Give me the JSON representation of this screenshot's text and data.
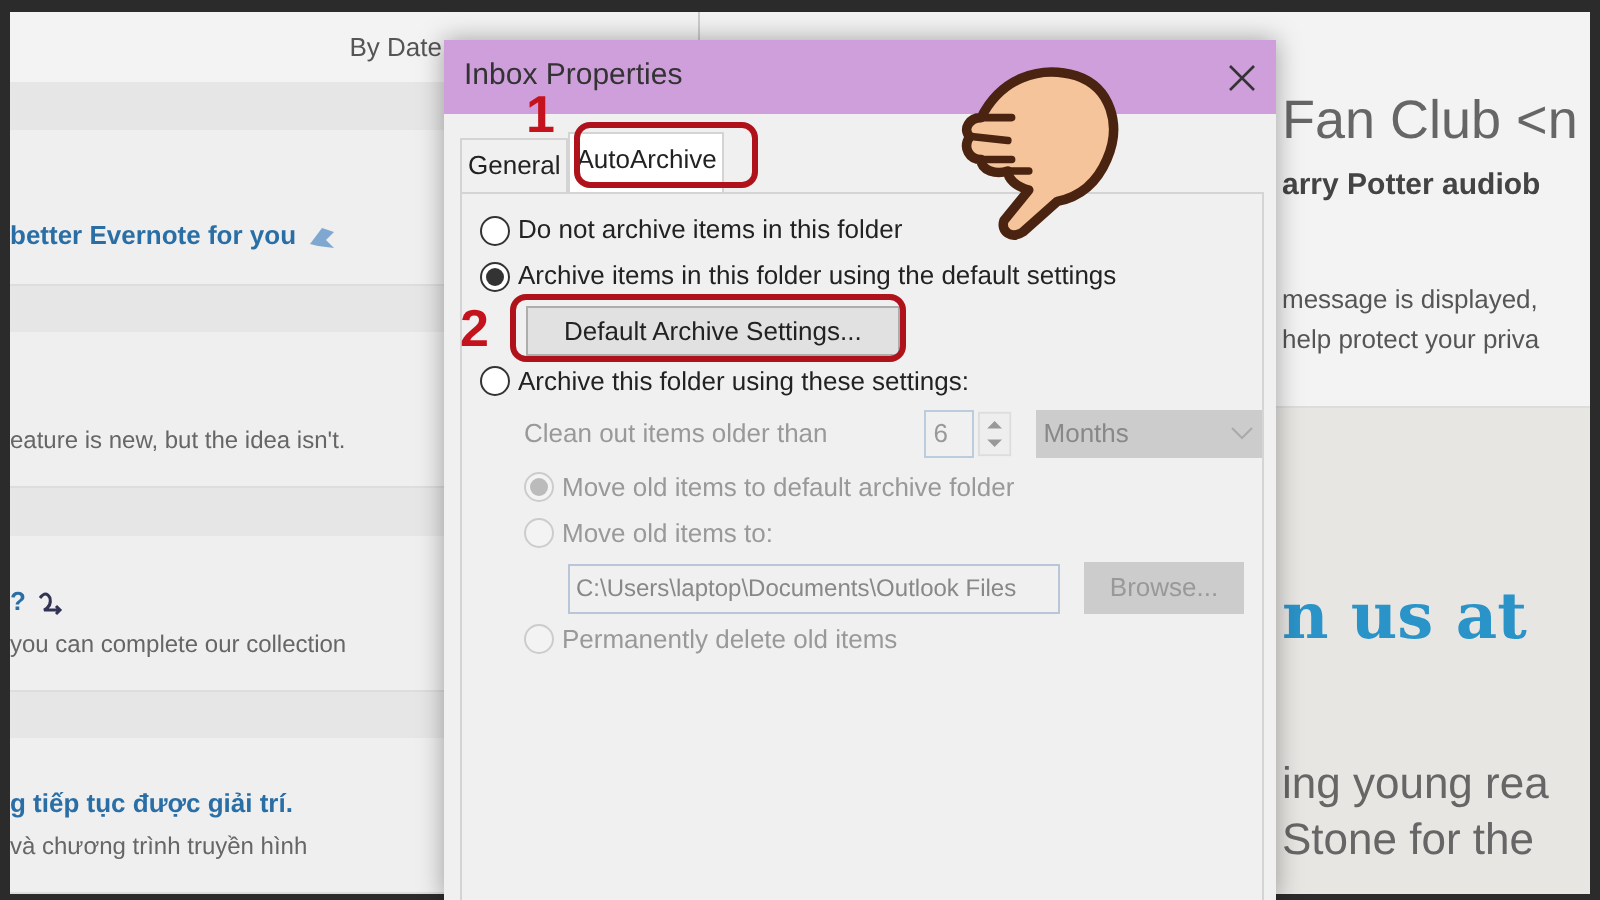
{
  "mail_list": {
    "sort_label": "By Date",
    "items": [
      {
        "title": "better Evernote for you"
      },
      {
        "preview": "eature is new, but the idea isn't."
      },
      {
        "title": "?",
        "preview": "you can complete our collection"
      },
      {
        "title": "g tiếp tục được giải trí.",
        "preview": "và chương trình truyền hình"
      }
    ]
  },
  "reading_pane": {
    "sender": "Fan Club <n",
    "subject": "arry Potter audiob",
    "notice": [
      "message is displayed,",
      "help protect your priva"
    ],
    "headline": "n us at",
    "body": [
      "ing young rea",
      "Stone for the"
    ]
  },
  "dialog": {
    "title": "Inbox Properties",
    "tabs": [
      {
        "label": "General",
        "selected": false
      },
      {
        "label": "AutoArchive",
        "selected": true
      }
    ],
    "options": [
      {
        "kind": "radio",
        "label": "Do not archive items in this folder",
        "checked": false,
        "disabled": false
      },
      {
        "kind": "radio",
        "label": "Archive items in this folder using the default settings",
        "checked": true,
        "disabled": false
      },
      {
        "kind": "button",
        "label": "Default Archive Settings..."
      },
      {
        "kind": "radio",
        "label": "Archive this folder using these settings:",
        "checked": false,
        "disabled": false
      }
    ],
    "settings": {
      "clean_label": "Clean out items older than",
      "age": "6",
      "unit": "Months",
      "sub_options": [
        {
          "kind": "radio",
          "label": "Move old items to default archive folder",
          "checked": true,
          "disabled": true
        },
        {
          "kind": "radio",
          "label": "Move old items to:",
          "checked": false,
          "disabled": true
        },
        {
          "kind": "path",
          "value": "C:\\Users\\laptop\\Documents\\Outlook Files",
          "button": "Browse..."
        },
        {
          "kind": "radio",
          "label": "Permanently delete old items",
          "checked": false,
          "disabled": true
        }
      ]
    }
  },
  "annotations": [
    {
      "label": "1"
    },
    {
      "label": "2"
    }
  ]
}
